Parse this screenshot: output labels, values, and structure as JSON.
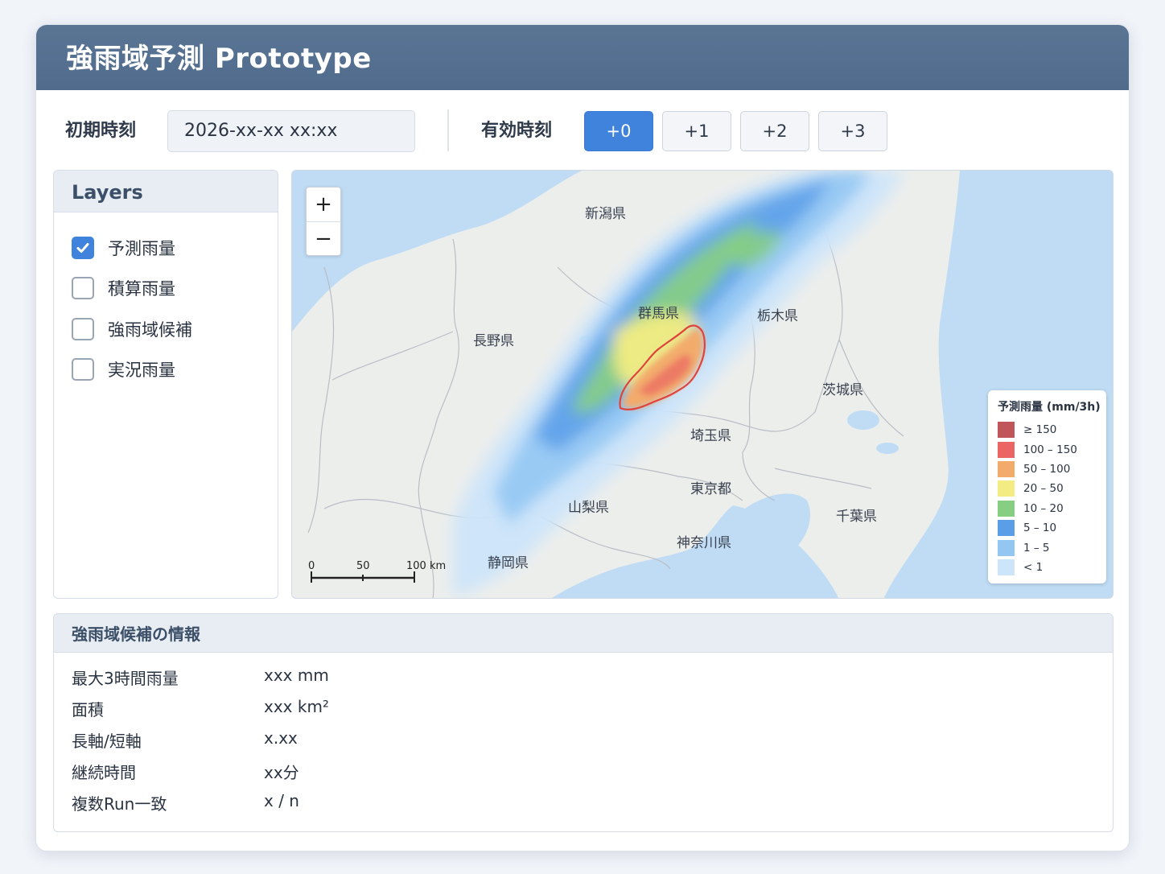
{
  "app": {
    "title": "強雨域予測 Prototype"
  },
  "toolbar": {
    "init_label": "初期時刻",
    "init_value": "2026-xx-xx xx:xx",
    "valid_label": "有効時刻",
    "offsets": [
      "+0",
      "+1",
      "+2",
      "+3"
    ],
    "active_offset": "+0",
    "accent_color": "#3f83dc"
  },
  "layers": {
    "title": "Layers",
    "items": [
      {
        "label": "予測雨量",
        "checked": true
      },
      {
        "label": "積算雨量",
        "checked": false
      },
      {
        "label": "強雨域候補",
        "checked": false
      },
      {
        "label": "実況雨量",
        "checked": false
      }
    ]
  },
  "map": {
    "zoom_in": "+",
    "zoom_out": "−",
    "prefectures": [
      "新潟県",
      "群馬県",
      "栃木県",
      "長野県",
      "茨城県",
      "埼玉県",
      "東京都",
      "山梨県",
      "千葉県",
      "神奈川県",
      "静岡県"
    ],
    "scale": {
      "labels": [
        "0",
        "50",
        "100 km"
      ]
    },
    "legend": {
      "title": "予測雨量 (mm/3h)",
      "entries": [
        {
          "label": "≥ 150",
          "color": "#c0555a"
        },
        {
          "label": "100 – 150",
          "color": "#ea6563"
        },
        {
          "label": "50 – 100",
          "color": "#f3ab6c"
        },
        {
          "label": "20 – 50",
          "color": "#f2ec83"
        },
        {
          "label": "10 – 20",
          "color": "#86cf82"
        },
        {
          "label": "5 – 10",
          "color": "#5b9ee8"
        },
        {
          "label": "1 – 5",
          "color": "#93c6f3"
        },
        {
          "label": "< 1",
          "color": "#cde5fa"
        }
      ]
    }
  },
  "info": {
    "title": "強雨域候補の情報",
    "rows": [
      {
        "key": "最大3時間雨量",
        "value": "xxx mm"
      },
      {
        "key": "面積",
        "value": "xxx km²"
      },
      {
        "key": "長軸/短軸",
        "value": "x.xx"
      },
      {
        "key": "継続時間",
        "value": "xx分"
      },
      {
        "key": "複数Run一致",
        "value": "x / n"
      }
    ]
  }
}
